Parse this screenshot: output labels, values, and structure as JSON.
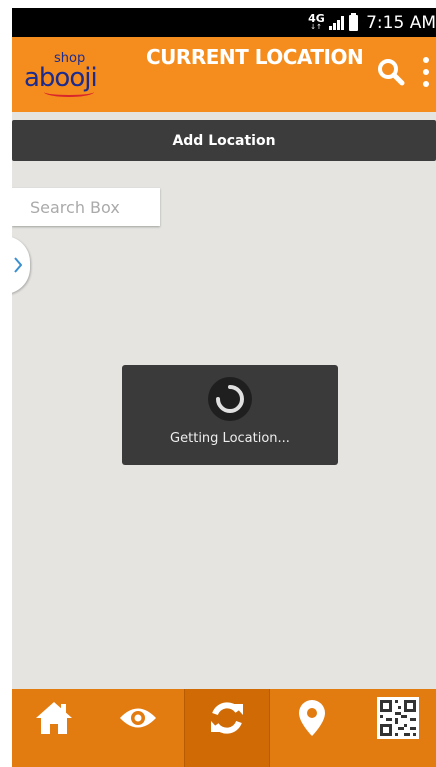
{
  "status_bar": {
    "network": "4G",
    "time": "7:15 AM"
  },
  "app_bar": {
    "logo_small": "shop",
    "logo_main": "abooji",
    "title": "CURRENT LOCATION"
  },
  "add_location": {
    "label": "Add Location"
  },
  "search": {
    "placeholder": "Search Box",
    "value": ""
  },
  "loading": {
    "message": "Getting Location..."
  },
  "bottom_nav": {
    "items": [
      {
        "icon": "home-icon",
        "active": false
      },
      {
        "icon": "eye-icon",
        "active": false
      },
      {
        "icon": "refresh-icon",
        "active": true
      },
      {
        "icon": "map-pin-icon",
        "active": false
      },
      {
        "icon": "qr-code-icon",
        "active": false
      }
    ]
  },
  "colors": {
    "accent": "#f58d1e",
    "bottom_bar": "#e27b10",
    "dark_button": "#3c3c3c",
    "map_background": "#e5e4e1"
  }
}
